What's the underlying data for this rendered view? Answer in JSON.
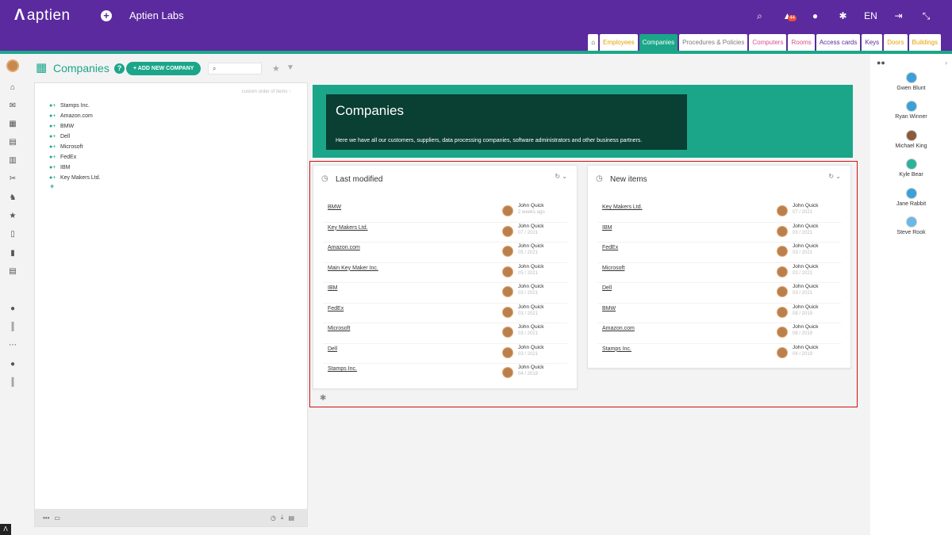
{
  "header": {
    "logo": "aptien",
    "org": "Aptien Labs",
    "notification_count": "44",
    "language": "EN",
    "tabs": [
      {
        "label": "Employees",
        "color": "#e6a100"
      },
      {
        "label": "Companies",
        "color": "#ffffff"
      },
      {
        "label": "Procedures & Policies",
        "color": "#7a7a7a"
      },
      {
        "label": "Computers",
        "color": "#d94d90"
      },
      {
        "label": "Rooms",
        "color": "#d94d90"
      },
      {
        "label": "Access cards",
        "color": "#5b2a9e"
      },
      {
        "label": "Keys",
        "color": "#5b2a9e"
      },
      {
        "label": "Doors",
        "color": "#e6a100"
      },
      {
        "label": "Buildings",
        "color": "#e6a100"
      }
    ]
  },
  "page": {
    "title": "Companies",
    "add_button": "+ ADD NEW COMPANY",
    "custom_order": "custom order of items"
  },
  "companies": [
    "Stamps Inc.",
    "Amazon.com",
    "BMW",
    "Dell",
    "Microsoft",
    "FedEx",
    "IBM",
    "Key Makers Ltd."
  ],
  "hero": {
    "title": "Companies",
    "description": "Here we have all our customers, suppliers, data processing companies, software administrators and other business partners."
  },
  "last_modified": {
    "title": "Last modified",
    "rows": [
      {
        "name": "BMW",
        "user": "John Quick",
        "when": "2 weeks ago"
      },
      {
        "name": "Key Makers Ltd.",
        "user": "John Quick",
        "when": "07 / 2021"
      },
      {
        "name": "Amazon.com",
        "user": "John Quick",
        "when": "05 / 2021"
      },
      {
        "name": "Main Key Maker Inc.",
        "user": "John Quick",
        "when": "05 / 2021"
      },
      {
        "name": "IBM",
        "user": "John Quick",
        "when": "03 / 2021"
      },
      {
        "name": "FedEx",
        "user": "John Quick",
        "when": "03 / 2021"
      },
      {
        "name": "Microsoft",
        "user": "John Quick",
        "when": "03 / 2021"
      },
      {
        "name": "Dell",
        "user": "John Quick",
        "when": "03 / 2021"
      },
      {
        "name": "Stamps Inc.",
        "user": "John Quick",
        "when": "04 / 2019"
      }
    ]
  },
  "new_items": {
    "title": "New items",
    "rows": [
      {
        "name": "Key Makers Ltd.",
        "user": "John Quick",
        "when": "07 / 2021"
      },
      {
        "name": "IBM",
        "user": "John Quick",
        "when": "03 / 2021"
      },
      {
        "name": "FedEx",
        "user": "John Quick",
        "when": "03 / 2021"
      },
      {
        "name": "Microsoft",
        "user": "John Quick",
        "when": "03 / 2021"
      },
      {
        "name": "Dell",
        "user": "John Quick",
        "when": "03 / 2021"
      },
      {
        "name": "BMW",
        "user": "John Quick",
        "when": "08 / 2019"
      },
      {
        "name": "Amazon.com",
        "user": "John Quick",
        "when": "08 / 2019"
      },
      {
        "name": "Stamps Inc.",
        "user": "John Quick",
        "when": "04 / 2019"
      }
    ]
  },
  "people": [
    {
      "name": "Gwen Blunt",
      "color": "#3aa0d8"
    },
    {
      "name": "Ryan Winner",
      "color": "#3aa0d8"
    },
    {
      "name": "Michael King",
      "color": "#8a5a3a"
    },
    {
      "name": "Kyle Bear",
      "color": "#2bb39a"
    },
    {
      "name": "Jane Rabbit",
      "color": "#3aa0d8"
    },
    {
      "name": "Steve Rook",
      "color": "#6ab8e8"
    }
  ]
}
